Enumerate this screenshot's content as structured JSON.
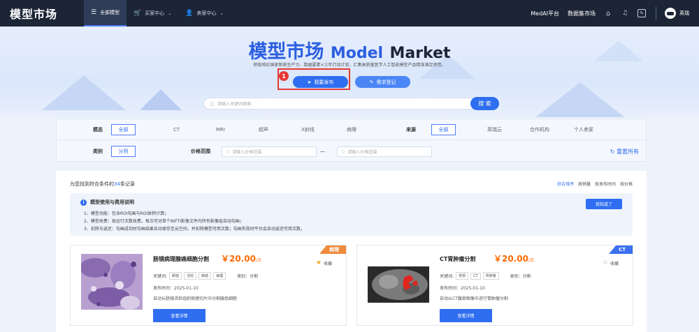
{
  "topbar": {
    "brand": "模型市场",
    "nav": [
      {
        "label": "全部模型",
        "icon": "grid-icon",
        "active": true
      },
      {
        "label": "买家中心",
        "icon": "cart-icon",
        "active": false
      },
      {
        "label": "卖家中心",
        "icon": "user-icon",
        "active": false
      }
    ],
    "links": [
      "MedAI平台",
      "数据集市场"
    ],
    "username": "英瑞"
  },
  "hero": {
    "title_cn": "模型市场",
    "title_en1": "Model",
    "title_en2": "Market",
    "subtitle": "积极响应国家新质生产力、数据要素×三年行动计划，汇集高质量医学人工智能模型产品精准满足使用。",
    "publish_label": "我要发布",
    "register_label": "需求登记",
    "step_badge": "1",
    "search_placeholder": "请输入关键词搜索",
    "search_label": "搜 索"
  },
  "filters": {
    "modality_label": "模态",
    "modality_options": [
      "全部",
      "CT",
      "MRI",
      "超声",
      "X射线",
      "病理"
    ],
    "source_label": "来源",
    "source_options": [
      "全部",
      "英瑞云",
      "合作机构",
      "个人卖家"
    ],
    "category_label": "类别",
    "category_selected": "分割",
    "price_label": "价格范围",
    "price_placeholder": "请输入价格范围",
    "price_sep": "—",
    "reset_label": "重置所有"
  },
  "results": {
    "count_prefix": "为您找到符合条件的",
    "count": "34",
    "count_suffix": "条记录",
    "sorts": [
      "综合排序",
      "按销量",
      "按发布时间",
      "按价格"
    ],
    "notice_title": "模型使用与费用说明",
    "notice_lines": [
      "1、模型功能：包含ROI勾画与ROI体积计算；",
      "2、模型收费：按运行次数收费，每次可对单个NIFTI影像文件内所有影像层自动勾画；",
      "3、扣除与返还：勾画成功时勾画结果自动保存至云空间，并扣除模型可用次数；勾画失败时平台会自动返还可用次数。"
    ],
    "notice_button": "我知道了"
  },
  "cards": [
    {
      "corner": "病理",
      "corner_color": "#f08a3c",
      "title": "肠镜病理腺癌细胞分割",
      "price": "￥20.00",
      "unit": "/次",
      "kw_label": "关键词:",
      "tags": [
        "肠镜",
        "活检",
        "腺癌",
        "病理"
      ],
      "category": "类别：分割",
      "date": "发布时间：2025-01-10",
      "desc": "自动从肠镜活检组织病理切片中分割腺癌细胞",
      "button": "查看详情",
      "fav": "收藏",
      "starred": true
    },
    {
      "corner": "CT",
      "corner_color": "#3b6ff0",
      "title": "CT胃肿瘤分割",
      "price": "￥20.00",
      "unit": "/次",
      "kw_label": "关键词:",
      "tags": [
        "胃部",
        "CT",
        "胃肿瘤"
      ],
      "category": "类别：分割",
      "date": "发布时间：2025-01-10",
      "desc": "自动从CT腹部图像中进行胃肿瘤分割",
      "button": "查看详情",
      "fav": "收藏",
      "starred": false
    }
  ]
}
